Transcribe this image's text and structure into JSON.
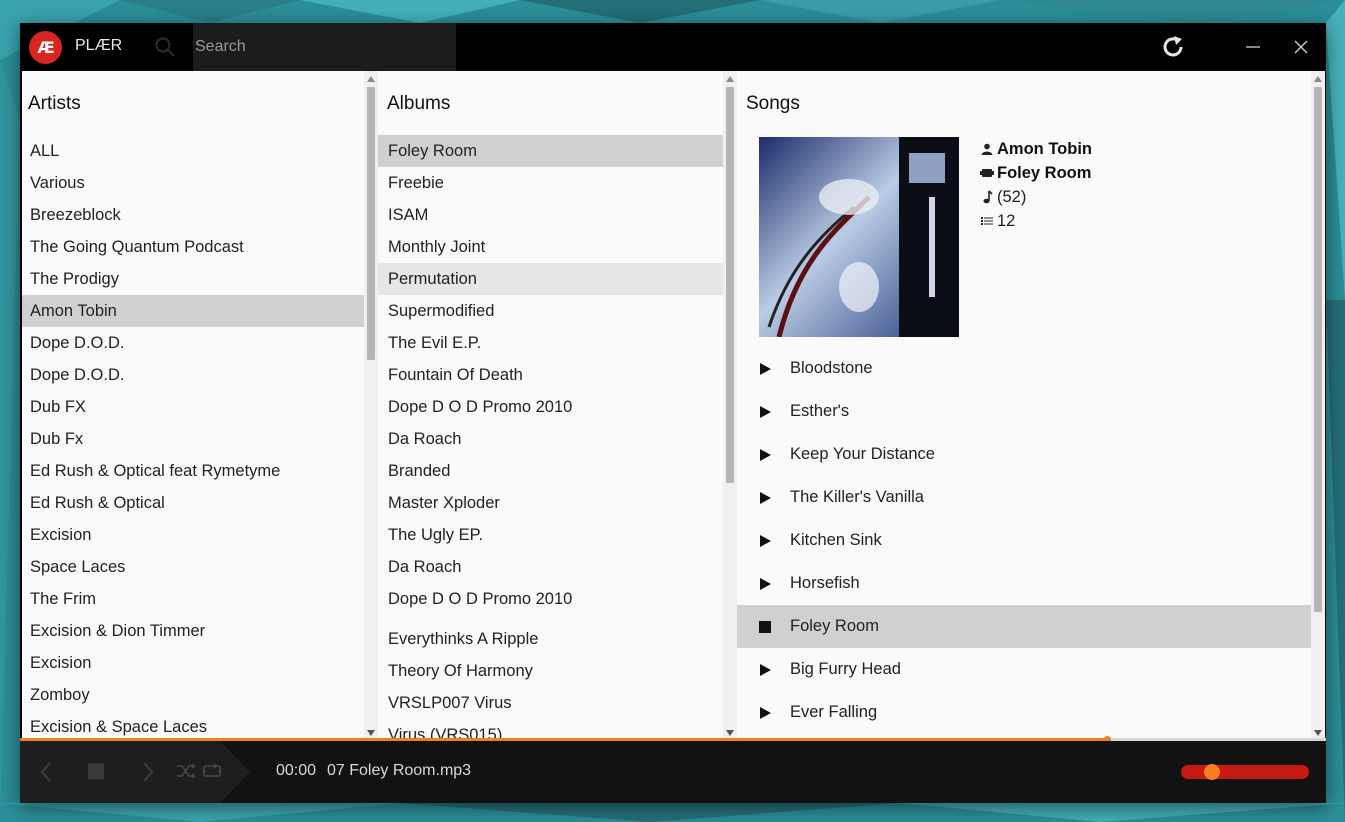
{
  "app": {
    "logo": "Æ",
    "title": "PLÆR",
    "search_placeholder": "Search"
  },
  "colors": {
    "accent": "#f08020",
    "logo_bg": "#d9251f",
    "volume_track": "#c41a12",
    "selected_row": "#d0d0d0"
  },
  "icons": {
    "search": "search-icon",
    "refresh": "refresh-icon",
    "minimize": "minimize-icon",
    "close": "close-icon",
    "artist": "person-icon",
    "album": "album-icon",
    "length": "music-note-icon",
    "tracks": "list-icon"
  },
  "artists": {
    "title": "Artists",
    "items": [
      "ALL",
      "Various",
      "Breezeblock",
      "The Going Quantum Podcast",
      "The Prodigy",
      "Amon Tobin",
      "Dope D.O.D.",
      "Dope D.O.D.",
      "Dub FX",
      "Dub Fx",
      "Ed Rush & Optical feat Rymetyme",
      "Ed Rush & Optical",
      "Excision",
      "Space Laces",
      "The Frim",
      "Excision & Dion Timmer",
      "Excision",
      "Zomboy",
      "Excision & Space Laces"
    ],
    "selected_index": 5
  },
  "albums": {
    "title": "Albums",
    "items": [
      "Foley Room",
      "Freebie",
      "ISAM",
      "Monthly Joint",
      "Permutation",
      "Supermodified",
      "The Evil E.P.",
      "Fountain Of Death",
      "Dope D O D Promo 2010",
      "Da Roach",
      "Branded",
      "Master Xploder",
      "The Ugly EP.",
      "Da Roach",
      "Dope D O D Promo 2010"
    ],
    "items_after_gap": [
      "Everythinks A Ripple",
      "Theory Of Harmony",
      "VRSLP007 Virus",
      "Virus (VRS015)"
    ],
    "selected_index": 0,
    "hover_index": 4
  },
  "songs": {
    "title": "Songs",
    "artist": "Amon Tobin",
    "album": "Foley Room",
    "length": "(52)",
    "track_count": "12",
    "items": [
      "Bloodstone",
      "Esther's",
      "Keep Your Distance",
      "The Killer's Vanilla",
      "Kitchen Sink",
      "Horsefish",
      "Foley Room",
      "Big Furry Head",
      "Ever Falling"
    ],
    "playing_index": 6
  },
  "player": {
    "time": "00:00",
    "file": "07 Foley Room.mp3",
    "progress": 0.832,
    "volume": 0.18
  }
}
